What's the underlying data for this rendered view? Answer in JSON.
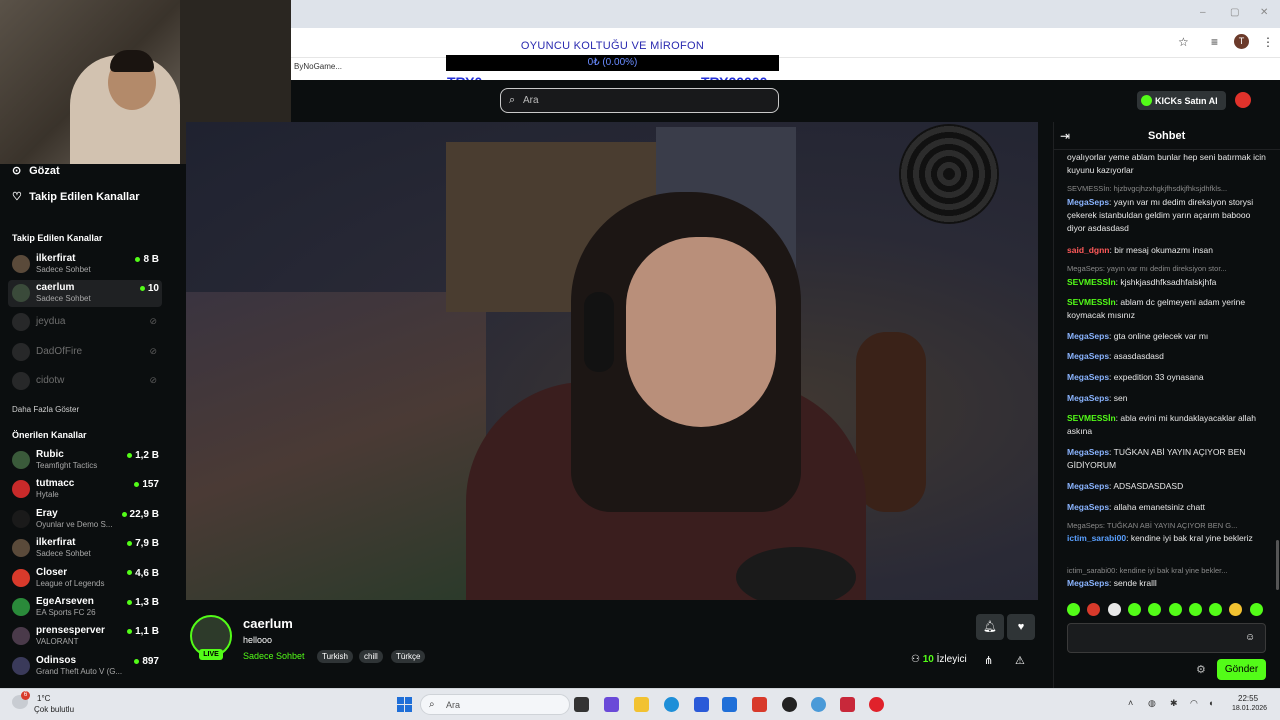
{
  "browser": {
    "bookmark": "ByNoGame...",
    "window_controls": [
      "–",
      "▢",
      "✕"
    ]
  },
  "donation": {
    "title": "OYUNCU KOLTUĞU VE MİROFON",
    "progress_text": "0₺ (0.00%)",
    "min_label": "TRY0",
    "max_label": "TRY20000",
    "progress": 0
  },
  "header": {
    "search_placeholder": "Ara",
    "kicks_button": "KICKs Satın Al"
  },
  "sidebar": {
    "nav": [
      {
        "icon": "compass-icon",
        "label": "Gözat"
      },
      {
        "icon": "heart-icon",
        "label": "Takip Edilen Kanallar"
      }
    ],
    "followed_title": "Takip Edilen Kanallar",
    "followed": [
      {
        "name": "ilkerfirat",
        "category": "Sadece Sohbet",
        "viewers": "8 B",
        "online": true
      },
      {
        "name": "caerlum",
        "category": "Sadece Sohbet",
        "viewers": "10",
        "online": true
      },
      {
        "name": "jeydua",
        "online": false
      },
      {
        "name": "DadOfFire",
        "online": false
      },
      {
        "name": "cidotw",
        "online": false
      }
    ],
    "show_more": "Daha Fazla Göster",
    "recommended_title": "Önerilen Kanallar",
    "recommended": [
      {
        "name": "Rubic",
        "category": "Teamfight Tactics",
        "viewers": "1,2 B"
      },
      {
        "name": "tutmacc",
        "category": "Hytale",
        "viewers": "157"
      },
      {
        "name": "Eray",
        "category": "Oyunlar ve Demo S...",
        "viewers": "22,9 B"
      },
      {
        "name": "ilkerfirat",
        "category": "Sadece Sohbet",
        "viewers": "7,9 B"
      },
      {
        "name": "Closer",
        "category": "League of Legends",
        "viewers": "4,6 B"
      },
      {
        "name": "EgeArseven",
        "category": "EA Sports FC 26",
        "viewers": "1,3 B"
      },
      {
        "name": "prensesperver",
        "category": "VALORANT",
        "viewers": "1,1 B"
      },
      {
        "name": "Odinsos",
        "category": "Grand Theft Auto V (G...",
        "viewers": "897"
      }
    ]
  },
  "stream": {
    "streamer": "caerlum",
    "live_badge": "LIVE",
    "title": "hellooo",
    "category": "Sadece Sohbet",
    "tags": [
      "Turkish",
      "chill",
      "Türkçe"
    ],
    "viewer_count": "10",
    "viewer_label": "İzleyici"
  },
  "chat": {
    "title": "Sohbet",
    "messages": [
      {
        "kind": "text",
        "user": "",
        "color": "#ffffff",
        "text": "oyalıyorlar yeme ablam bunlar hep seni batırmak icin kuyunu kazıyorlar"
      },
      {
        "kind": "reply",
        "text": "SEVMESSİn: hjzbvgcjhzxhgkjfhsdkjfhksjdhfkls..."
      },
      {
        "kind": "text",
        "user": "MegaSeps",
        "color": "#8ab4ff",
        "text": "yayın var mı dedim direksiyon storysi çekerek istanbuldan geldim yarın açarım babooo diyor asdasdasd"
      },
      {
        "kind": "text",
        "user": "said_dgnn",
        "color": "#ff5a5a",
        "text": "bir mesaj okumazmı insan"
      },
      {
        "kind": "reply",
        "text": "MegaSeps: yayın var mı dedim direksiyon stor..."
      },
      {
        "kind": "text",
        "user": "SEVMESSİn",
        "color": "#53fc18",
        "text": "kjshkjasdhfksadhfalskjhfa"
      },
      {
        "kind": "text",
        "user": "SEVMESSİn",
        "color": "#53fc18",
        "text": "ablam dc gelmeyeni adam yerine koymacak mısınız"
      },
      {
        "kind": "text",
        "user": "MegaSeps",
        "color": "#8ab4ff",
        "text": "gta online gelecek var mı"
      },
      {
        "kind": "text",
        "user": "MegaSeps",
        "color": "#8ab4ff",
        "text": "asasdasdasd"
      },
      {
        "kind": "text",
        "user": "MegaSeps",
        "color": "#8ab4ff",
        "text": "expedition 33 oynasana"
      },
      {
        "kind": "text",
        "user": "MegaSeps",
        "color": "#8ab4ff",
        "text": "sen"
      },
      {
        "kind": "text",
        "user": "SEVMESSİn",
        "color": "#53fc18",
        "text": "abla evini mi kundaklayacaklar allah askına"
      },
      {
        "kind": "text",
        "user": "MegaSeps",
        "color": "#8ab4ff",
        "text": "TUĞKAN ABİ YAYIN AÇIYOR BEN GİDİYORUM"
      },
      {
        "kind": "text",
        "user": "MegaSeps",
        "color": "#8ab4ff",
        "text": "ADSASDASDASD"
      },
      {
        "kind": "text",
        "user": "MegaSeps",
        "color": "#8ab4ff",
        "text": "allaha emanetsiniz chatt"
      },
      {
        "kind": "reply",
        "text": "MegaSeps: TUĞKAN ABİ YAYIN AÇIYOR BEN G..."
      },
      {
        "kind": "text",
        "user": "ictim_sarabi00",
        "color": "#5aa0ff",
        "text": "kendine iyi bak kral yine bekleriz"
      },
      {
        "kind": "reply",
        "text": "ictim_sarabi00: kendine iyi bak kral yine bekler..."
      },
      {
        "kind": "text",
        "user": "MegaSeps",
        "color": "#8ab4ff",
        "text": "sende kralll"
      }
    ],
    "send_button": "Gönder"
  },
  "taskbar": {
    "weather_badge": "6",
    "temperature": "1°C",
    "weather": "Çok bulutlu",
    "search_placeholder": "Ara",
    "time": "22:55",
    "date": "18.01.2026"
  },
  "colors": {
    "accent": "#53fc18",
    "background": "#0b0e0f",
    "panel": "#2f3436"
  }
}
